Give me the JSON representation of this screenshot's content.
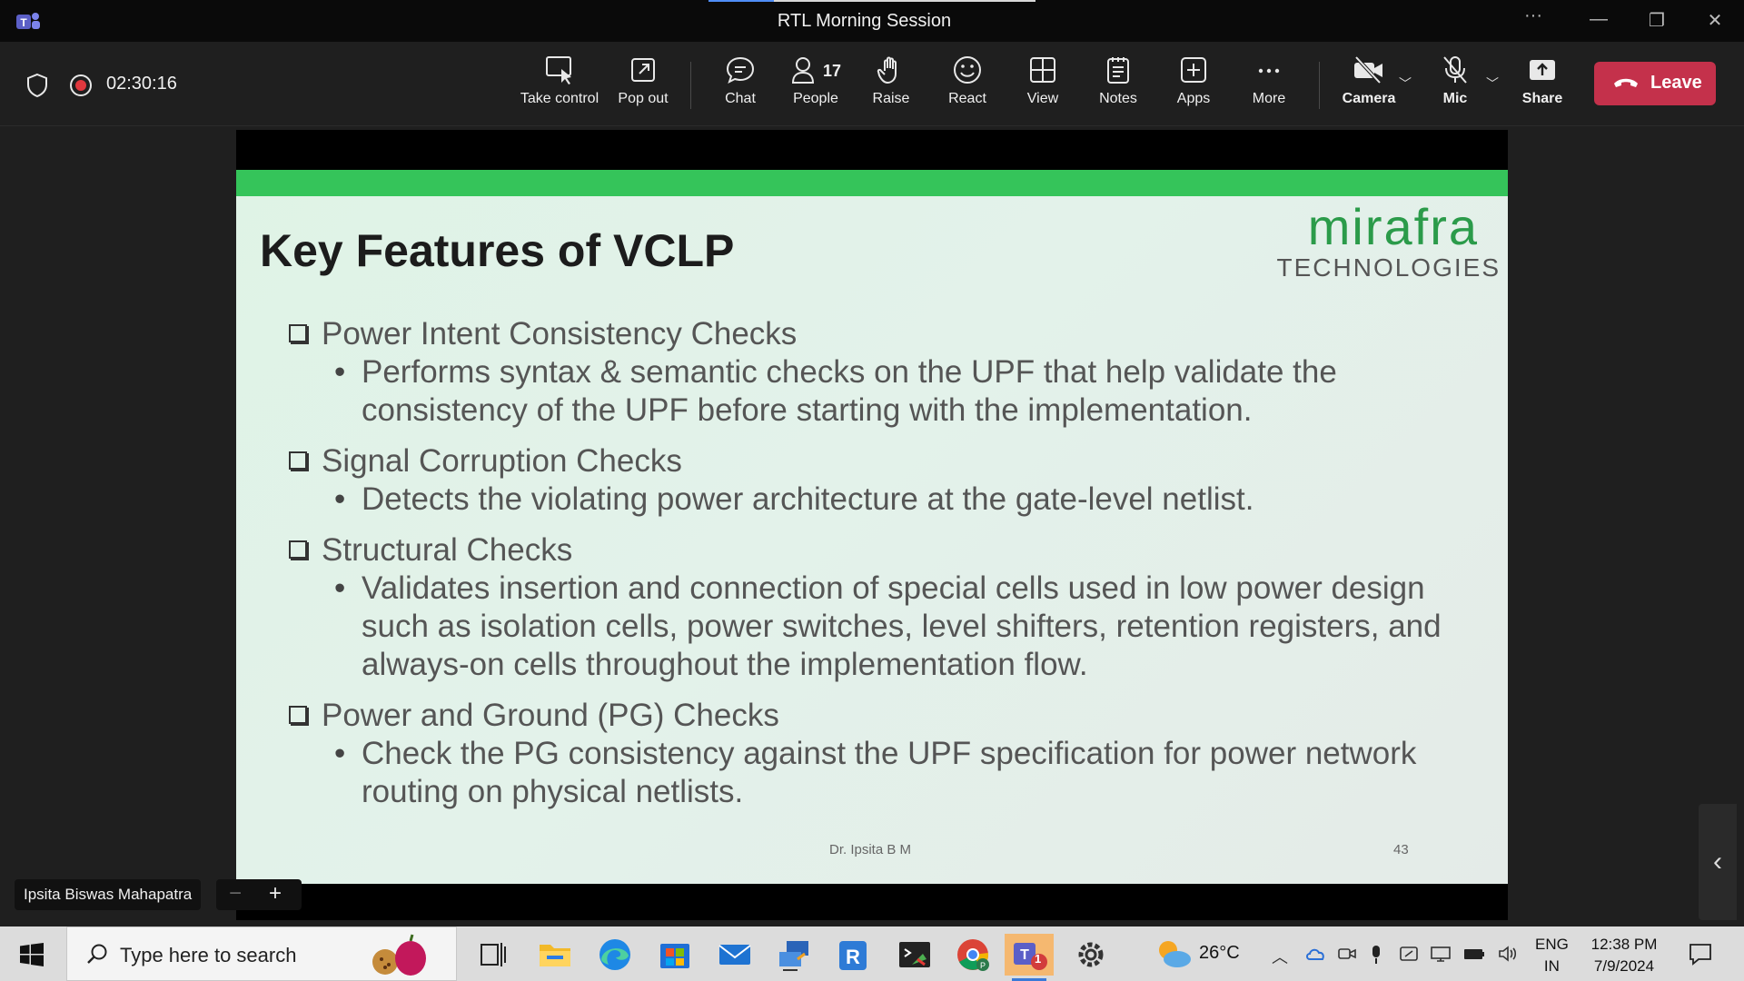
{
  "window": {
    "title": "RTL Morning Session"
  },
  "meeting": {
    "elapsed": "02:30:16"
  },
  "toolbar": {
    "take_control": "Take control",
    "pop_out": "Pop out",
    "chat": "Chat",
    "people": "People",
    "people_count": "17",
    "raise": "Raise",
    "react": "React",
    "view": "View",
    "notes": "Notes",
    "apps": "Apps",
    "more": "More",
    "camera": "Camera",
    "mic": "Mic",
    "share": "Share",
    "leave": "Leave"
  },
  "slide": {
    "title": "Key Features of VCLP",
    "logo_main": "mirafra",
    "logo_sub": "TECHNOLOGIES",
    "sections": [
      {
        "heading": "Power Intent Consistency Checks",
        "bullet": "Performs syntax & semantic checks on the UPF that help validate the consistency of the UPF before starting with the implementation."
      },
      {
        "heading": "Signal Corruption Checks",
        "bullet": "Detects the violating power architecture at the gate-level netlist."
      },
      {
        "heading": "Structural Checks",
        "bullet": "Validates insertion and connection of special cells used in low power design such as isolation cells, power switches, level shifters, retention registers, and always-on cells throughout the implementation flow."
      },
      {
        "heading": "Power and Ground (PG) Checks",
        "bullet": "Check the PG consistency against the UPF specification for power network routing on physical netlists."
      }
    ],
    "footer_name": "Dr. Ipsita B M",
    "page_number": "43"
  },
  "presenter": {
    "name": "Ipsita Biswas Mahapatra"
  },
  "taskbar": {
    "search_placeholder": "Type here to search",
    "teams_badge": "1",
    "temperature": "26°C",
    "lang_line1": "ENG",
    "lang_line2": "IN",
    "time": "12:38 PM",
    "date": "7/9/2024"
  },
  "colors": {
    "accent_green": "#35c45a",
    "leave_red": "#c4314b",
    "logo_green": "#2b9b4a"
  }
}
